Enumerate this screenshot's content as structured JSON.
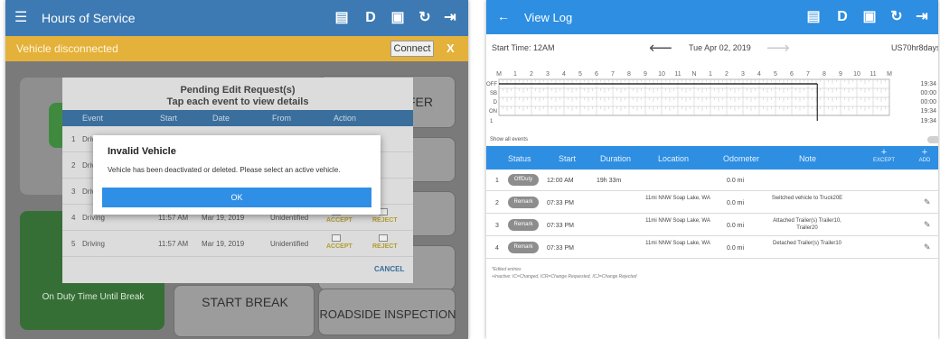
{
  "left": {
    "header": {
      "menu_icon": "hamburger-menu-icon",
      "title": "Hours of Service",
      "icons": [
        "message-icon",
        "D",
        "monitor-icon",
        "refresh-icon",
        "logout-icon"
      ]
    },
    "banner": {
      "text": "Vehicle disconnected",
      "connect_label": "Connect",
      "close_label": "X"
    },
    "background": {
      "transfer_label": "FER",
      "on_duty_label": "On Duty Time Until Break",
      "start_break_label": "START BREAK",
      "roadside_label": "ROADSIDE INSPECTION"
    },
    "pending": {
      "title_line1": "Pending Edit Request(s)",
      "title_line2": "Tap each event to view details",
      "columns": [
        "Event",
        "Start",
        "Date",
        "From",
        "Action"
      ],
      "rows": [
        {
          "num": "1",
          "event": "Driv",
          "start": "",
          "date": "",
          "from": ""
        },
        {
          "num": "2",
          "event": "Driv",
          "start": "",
          "date": "",
          "from": ""
        },
        {
          "num": "3",
          "event": "Driv",
          "start": "",
          "date": "",
          "from": ""
        },
        {
          "num": "4",
          "event": "Driving",
          "start": "11:57 AM",
          "date": "Mar 19, 2019",
          "from": "Unidentified"
        },
        {
          "num": "5",
          "event": "Driving",
          "start": "11:57 AM",
          "date": "Mar 19, 2019",
          "from": "Unidentified"
        }
      ],
      "accept_label": "ACCEPT",
      "reject_label": "REJECT",
      "cancel_label": "CANCEL"
    },
    "modal": {
      "title": "Invalid Vehicle",
      "message": "Vehicle has been deactivated or deleted. Please select an active vehicle.",
      "ok_label": "OK"
    }
  },
  "right": {
    "header": {
      "back_icon": "back-arrow-icon",
      "title": "View Log",
      "icons": [
        "message-icon",
        "D",
        "monitor-icon",
        "refresh-icon",
        "logout-icon"
      ]
    },
    "nav": {
      "start_time": "Start Time: 12AM",
      "date": "Tue Apr 02, 2019",
      "cycle": "US70hr8days"
    },
    "chart_data": {
      "type": "line",
      "title": "",
      "hour_labels": [
        "M",
        "1",
        "2",
        "3",
        "4",
        "5",
        "6",
        "7",
        "8",
        "9",
        "10",
        "11",
        "N",
        "1",
        "2",
        "3",
        "4",
        "5",
        "6",
        "7",
        "8",
        "9",
        "10",
        "11",
        "M"
      ],
      "rows": [
        "OFF",
        "SB",
        "D",
        "ON"
      ],
      "bottom_label": "1",
      "totals": [
        "19:34",
        "00:00",
        "00:00",
        "19:34"
      ],
      "segments": [
        {
          "status": "OFF",
          "start_hour": 0,
          "end_hour": 19.57
        }
      ]
    },
    "show_all": "Show all events",
    "table": {
      "columns": [
        "Status",
        "Start",
        "Duration",
        "Location",
        "Odometer",
        "Note"
      ],
      "except_label": "EXCEPT",
      "add_label": "ADD",
      "rows": [
        {
          "num": "1",
          "status": "OffDuty",
          "start": "12:00 AM",
          "duration": "19h 33m",
          "location": "",
          "odometer": "0.0 mi",
          "note": "",
          "editable": false
        },
        {
          "num": "2",
          "status": "Remark",
          "start": "07:33 PM",
          "duration": "",
          "location": "11mi NNW Soap Lake, WA",
          "odometer": "0.0 mi",
          "note": "Switched vehicle to Truck20E",
          "editable": true
        },
        {
          "num": "3",
          "status": "Remark",
          "start": "07:33 PM",
          "duration": "",
          "location": "11mi NNW Soap Lake, WA",
          "odometer": "0.0 mi",
          "note": "Attached Trailer(s) Trailer10, Trailer20",
          "editable": true
        },
        {
          "num": "4",
          "status": "Remark",
          "start": "07:33 PM",
          "duration": "",
          "location": "11mi NNW Soap Lake, WA",
          "odometer": "0.0 mi",
          "note": "Detached Trailer(s) Trailer10",
          "editable": true
        }
      ]
    },
    "footnote1": "*Edited entries",
    "footnote2": "+Inactive: IC=Changed, ICR=Change Requested, ICJ=Change Rejected"
  }
}
